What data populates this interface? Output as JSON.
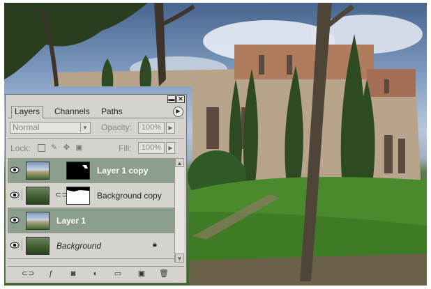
{
  "palette": {
    "tabs": [
      "Layers",
      "Channels",
      "Paths"
    ],
    "blend_mode": "Normal",
    "opacity_label": "Opacity:",
    "opacity_value": "100%",
    "lock_label": "Lock:",
    "fill_label": "Fill:",
    "fill_value": "100%",
    "layers": [
      {
        "name": "Layer 1 copy",
        "selected": true,
        "has_mask": true
      },
      {
        "name": "Background copy",
        "selected": false,
        "has_mask": true
      },
      {
        "name": "Layer 1",
        "selected": true,
        "has_mask": false
      },
      {
        "name": "Background",
        "selected": false,
        "has_mask": false,
        "locked": true
      }
    ]
  },
  "colors": {
    "panel": "#d6d3ce",
    "selected_row": "#8b9e8b"
  },
  "icons": [
    "eye-icon",
    "chain-icon",
    "lock-icon",
    "link-layers-icon",
    "layer-style-icon",
    "add-mask-icon",
    "adjustment-layer-icon",
    "new-group-icon",
    "new-layer-icon",
    "delete-layer-icon"
  ]
}
